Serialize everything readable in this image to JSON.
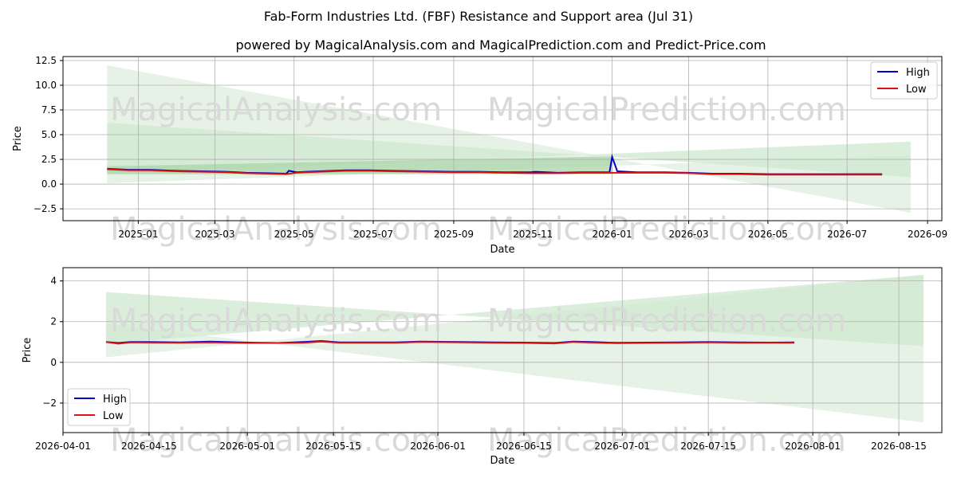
{
  "title": "Fab-Form Industries Ltd. (FBF) Resistance and Support area (Jul 31)",
  "subtitle": "powered by MagicalAnalysis.com and MagicalPrediction.com and Predict-Price.com",
  "watermarks": [
    "MagicalAnalysis.com",
    "MagicalPrediction.com"
  ],
  "colors": {
    "high": "#0000cc",
    "low": "#dd1111",
    "band_light": "#cfe8cf",
    "band_dark": "#a9d5a9",
    "grid": "#b0b0b0",
    "watermark": "#d9d9d9"
  },
  "chart_data": [
    {
      "type": "line",
      "xlabel": "Date",
      "ylabel": "Price",
      "grid": true,
      "legend": {
        "entries": [
          "High",
          "Low"
        ],
        "placement": "top-right"
      },
      "xlim": [
        "2024-11-04",
        "2026-09-12"
      ],
      "ylim": [
        -3.7,
        12.9
      ],
      "x_ticks": [
        "2025-01",
        "2025-03",
        "2025-05",
        "2025-07",
        "2025-09",
        "2025-11",
        "2026-01",
        "2026-03",
        "2026-05",
        "2026-07",
        "2026-09"
      ],
      "y_ticks": [
        "12.5",
        "10.0",
        "7.5",
        "5.0",
        "2.5",
        "0.0",
        "−2.5"
      ],
      "series": [
        {
          "name": "High",
          "x": [
            "2024-12-08",
            "2024-12-25",
            "2025-01-10",
            "2025-01-30",
            "2025-02-20",
            "2025-03-10",
            "2025-03-25",
            "2025-04-10",
            "2025-04-25",
            "2025-04-27",
            "2025-05-03",
            "2025-05-20",
            "2025-06-10",
            "2025-06-28",
            "2025-07-15",
            "2025-08-10",
            "2025-08-30",
            "2025-09-20",
            "2025-10-10",
            "2025-10-30",
            "2025-11-03",
            "2025-11-20",
            "2025-12-10",
            "2025-12-30",
            "2026-01-01",
            "2026-01-05",
            "2026-01-20",
            "2026-02-10",
            "2026-03-01",
            "2026-03-20",
            "2026-04-10",
            "2026-05-01",
            "2026-05-20",
            "2026-06-10",
            "2026-07-01",
            "2026-07-28"
          ],
          "values": [
            1.55,
            1.45,
            1.45,
            1.35,
            1.3,
            1.25,
            1.15,
            1.1,
            1.05,
            1.35,
            1.2,
            1.3,
            1.4,
            1.4,
            1.35,
            1.3,
            1.25,
            1.25,
            1.2,
            1.2,
            1.25,
            1.15,
            1.2,
            1.2,
            2.75,
            1.3,
            1.2,
            1.2,
            1.15,
            1.05,
            1.05,
            1.0,
            1.0,
            1.0,
            1.0,
            1.0
          ]
        },
        {
          "name": "Low",
          "x": [
            "2024-12-08",
            "2024-12-25",
            "2025-01-10",
            "2025-01-30",
            "2025-02-20",
            "2025-03-10",
            "2025-03-25",
            "2025-04-10",
            "2025-04-25",
            "2025-05-03",
            "2025-05-20",
            "2025-06-10",
            "2025-06-28",
            "2025-07-15",
            "2025-08-10",
            "2025-08-30",
            "2025-09-20",
            "2025-10-10",
            "2025-10-30",
            "2025-11-20",
            "2025-12-10",
            "2026-01-01",
            "2026-01-20",
            "2026-02-10",
            "2026-03-01",
            "2026-03-20",
            "2026-04-10",
            "2026-05-01",
            "2026-05-20",
            "2026-06-10",
            "2026-07-01",
            "2026-07-28"
          ],
          "values": [
            1.5,
            1.4,
            1.4,
            1.3,
            1.25,
            1.2,
            1.1,
            1.05,
            1.0,
            1.15,
            1.25,
            1.35,
            1.35,
            1.3,
            1.25,
            1.2,
            1.2,
            1.15,
            1.1,
            1.1,
            1.15,
            1.15,
            1.15,
            1.15,
            1.1,
            1.0,
            1.0,
            0.95,
            0.95,
            0.95,
            0.95,
            0.95
          ]
        }
      ],
      "bands": [
        {
          "x": [
            "2024-12-08",
            "2026-08-19"
          ],
          "upper": [
            12.0,
            -2.9
          ],
          "lower": [
            0.1,
            2.9
          ]
        },
        {
          "x": [
            "2024-12-08",
            "2026-08-19"
          ],
          "upper": [
            6.2,
            0.7
          ],
          "lower": [
            1.0,
            4.3
          ]
        },
        {
          "x": [
            "2024-12-08",
            "2026-01-01"
          ],
          "upper": [
            1.8,
            2.8
          ],
          "lower": [
            1.0,
            1.0
          ]
        }
      ]
    },
    {
      "type": "line",
      "xlabel": "Date",
      "ylabel": "Price",
      "grid": true,
      "legend": {
        "entries": [
          "High",
          "Low"
        ],
        "placement": "bottom-left"
      },
      "xlim": [
        "2026-04-01",
        "2026-08-22"
      ],
      "ylim": [
        -3.45,
        4.65
      ],
      "x_ticks": [
        "2026-04-01",
        "2026-04-15",
        "2026-05-01",
        "2026-05-15",
        "2026-06-01",
        "2026-06-15",
        "2026-07-01",
        "2026-07-15",
        "2026-08-01",
        "2026-08-15"
      ],
      "y_ticks": [
        "4",
        "2",
        "0",
        "−2"
      ],
      "series": [
        {
          "name": "High",
          "x": [
            "2026-04-08",
            "2026-04-10",
            "2026-04-12",
            "2026-04-15",
            "2026-04-20",
            "2026-04-25",
            "2026-05-01",
            "2026-05-06",
            "2026-05-10",
            "2026-05-13",
            "2026-05-16",
            "2026-05-20",
            "2026-05-25",
            "2026-05-29",
            "2026-06-05",
            "2026-06-10",
            "2026-06-15",
            "2026-06-20",
            "2026-06-23",
            "2026-06-26",
            "2026-06-30",
            "2026-07-05",
            "2026-07-10",
            "2026-07-15",
            "2026-07-20",
            "2026-07-25",
            "2026-07-29"
          ],
          "values": [
            1.0,
            0.95,
            1.0,
            1.0,
            0.98,
            1.02,
            0.97,
            0.95,
            1.0,
            1.05,
            0.98,
            0.98,
            0.98,
            1.02,
            1.0,
            0.98,
            0.97,
            0.95,
            1.02,
            1.0,
            0.96,
            0.97,
            0.98,
            1.0,
            0.98,
            0.97,
            0.98
          ]
        },
        {
          "name": "Low",
          "x": [
            "2026-04-08",
            "2026-04-10",
            "2026-04-12",
            "2026-04-15",
            "2026-04-20",
            "2026-04-25",
            "2026-05-01",
            "2026-05-06",
            "2026-05-10",
            "2026-05-13",
            "2026-05-16",
            "2026-05-20",
            "2026-05-25",
            "2026-05-29",
            "2026-06-05",
            "2026-06-10",
            "2026-06-15",
            "2026-06-20",
            "2026-06-23",
            "2026-06-26",
            "2026-06-30",
            "2026-07-05",
            "2026-07-10",
            "2026-07-15",
            "2026-07-20",
            "2026-07-25",
            "2026-07-29"
          ],
          "values": [
            1.0,
            0.92,
            0.98,
            0.97,
            0.96,
            0.98,
            0.95,
            0.95,
            0.96,
            1.02,
            0.96,
            0.96,
            0.96,
            1.0,
            0.98,
            0.96,
            0.95,
            0.93,
            1.0,
            0.97,
            0.94,
            0.95,
            0.96,
            0.98,
            0.96,
            0.96,
            0.96
          ]
        }
      ],
      "bands": [
        {
          "x": [
            "2026-04-08",
            "2026-08-19"
          ],
          "upper": [
            1.9,
            -2.95
          ],
          "lower": [
            0.25,
            4.3
          ]
        },
        {
          "x": [
            "2026-04-08",
            "2026-08-19"
          ],
          "upper": [
            3.45,
            0.8
          ],
          "lower": [
            0.9,
            4.3
          ]
        }
      ]
    }
  ]
}
